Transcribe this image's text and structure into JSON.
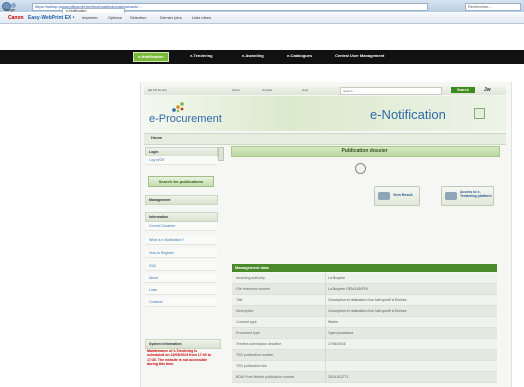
{
  "browser": {
    "address": "https://simap.pulsepdfcorner.be/enot/publicdomain/search/...",
    "search_placeholder": "Rechercher...",
    "tab_google": "Google",
    "tab_active": "e-Notification"
  },
  "bookmarks": {
    "canon": "Canon",
    "easy_webprint": "Easy-WebPrint EX •",
    "imprimer": "Imprimer",
    "options": "Options",
    "selection": "Sélection",
    "dernier": "Dernier jobs",
    "liste": "Liste elbes"
  },
  "topnav": {
    "notification": "e-Notification",
    "tendering": "e-Tendering",
    "awarding": "e-Awarding",
    "catalogues": "e-Catalogues",
    "central": "Central User Management"
  },
  "util": {
    "lang": "DE FR NL EN",
    "about": "About",
    "contact": "Contact",
    "help": "Help",
    "search_placeholder": "Search...",
    "search_button": "Search",
    "lang_code": "Jw"
  },
  "header": {
    "logo_text": "e-Procurement",
    "title": "e-Notification"
  },
  "breadcrumb": {
    "home": "Home"
  },
  "sidebar": {
    "login_head": "Login",
    "login_item": "Log in/Off",
    "search_btn": "Search for publications",
    "management_head": "Management",
    "information_head": "Information",
    "info_items": [
      "Correct Dossiers",
      "What is e-Notification?",
      "How to Register",
      "FAQ",
      "About",
      "Links",
      "Contacts"
    ],
    "sysinfo_head": "System information",
    "sysinfo_text": "Maintenance of e-Tendering is scheduled on 12/05/2024 from 17:00 to 17:30. The website is not accessible during this time."
  },
  "main": {
    "dossier_title": "Publication dossier",
    "view_results": "View Result",
    "access_tendering": "Access to e-Tendering platform"
  },
  "management_data": {
    "title": "Management data",
    "rows": [
      [
        "Awarding authority",
        "La Bruyère"
      ],
      [
        "File reference number",
        "La Bruyère GEN/145/P16"
      ],
      [
        "Title",
        "Conception et réalisation d'un hall sportif à Emines"
      ],
      [
        "Description",
        "Conception et réalisation d'un hall sportif à Emines"
      ],
      [
        "Contract type",
        "Works"
      ],
      [
        "Procedure type",
        "Open procedure"
      ],
      [
        "Tenders submission deadline",
        "17/06/2016"
      ],
      [
        "TED publication number",
        ""
      ],
      [
        "TED publication link",
        ""
      ],
      [
        "BDA/ Free Market publication number",
        "2016-512771"
      ]
    ]
  }
}
